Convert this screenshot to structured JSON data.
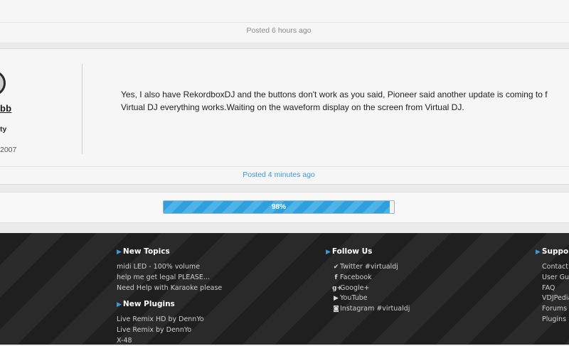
{
  "previous_post": {
    "posted": "Posted 6 hours ago"
  },
  "post": {
    "user": {
      "name_fragment": "bb",
      "rank_fragment": "ty",
      "since_fragment": "2007"
    },
    "text_line1": "Yes, I also have RekordboxDJ and the buttons don't work as you said, Pioneer said another update is coming to f",
    "text_line2": "Virtual DJ everything works.Waiting on the waveform display on the screen from Virtual DJ.",
    "posted": "Posted 4 minutes ago"
  },
  "progress": {
    "label": "98%",
    "value": 0.98
  },
  "footer": {
    "new_topics": {
      "heading": "New Topics",
      "items": [
        "midi LED - 100% volume",
        "help me get legal PLEASE...",
        "Need Help with Karaoke please"
      ]
    },
    "new_plugins": {
      "heading": "New Plugins",
      "items": [
        "Live Remix HD by DennYo",
        "Live Remix by DennYo",
        "X-48"
      ]
    },
    "follow_us": {
      "heading": "Follow Us",
      "items": [
        {
          "icon": "twitter-icon",
          "label": "Twitter #virtualdj"
        },
        {
          "icon": "facebook-icon",
          "label": "Facebook"
        },
        {
          "icon": "google-plus-icon",
          "label": "Google+"
        },
        {
          "icon": "youtube-icon",
          "label": "YouTube"
        },
        {
          "icon": "instagram-icon",
          "label": "Instagram #virtualdj"
        }
      ]
    },
    "support": {
      "heading": "Support",
      "items": [
        "Contact",
        "User Gu",
        "FAQ",
        "VDJPedia",
        "Forums",
        "Plugins"
      ]
    }
  },
  "colors": {
    "accent": "#3b9ad6",
    "footer_bg": "#222222",
    "progress": "#2fa0dc"
  }
}
